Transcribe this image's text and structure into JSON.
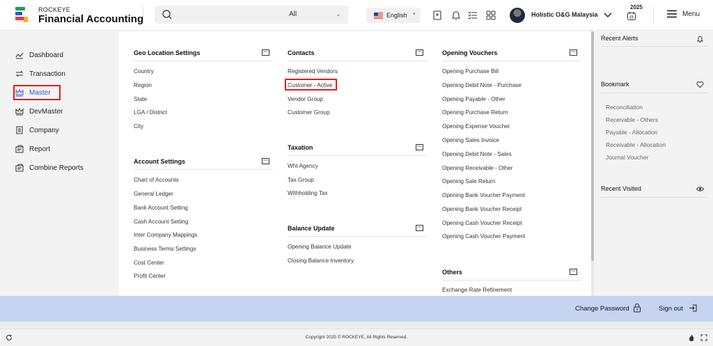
{
  "header": {
    "brand_small": "ROCKEYE",
    "brand_big": "Financial Accounting",
    "search_scope": "All",
    "language": "English",
    "company": "Holistic O&G Malaysia",
    "year": "2025",
    "menu_label": "Menu"
  },
  "sidebar": {
    "items": [
      {
        "label": "Dashboard",
        "icon": "dashboard-icon"
      },
      {
        "label": "Transaction",
        "icon": "transfer-icon"
      },
      {
        "label": "Master",
        "icon": "crown-icon"
      },
      {
        "label": "DevMaster",
        "icon": "crown-icon"
      },
      {
        "label": "Company",
        "icon": "building-icon"
      },
      {
        "label": "Report",
        "icon": "report-icon"
      },
      {
        "label": "Combine Reports",
        "icon": "report-icon"
      }
    ],
    "active": "Master"
  },
  "panel": {
    "geo": {
      "title": "Geo Location Settings",
      "items": [
        "Country",
        "Region",
        "State",
        "LGA / District",
        "City"
      ]
    },
    "account": {
      "title": "Account Settings",
      "items": [
        "Chart of Accounts",
        "General Ledger",
        "Bank Account Setting",
        "Cash Account Setting",
        "Inter Company Mappings",
        "Business Terms Settings",
        "Cost Center",
        "Profit Center"
      ]
    },
    "contacts": {
      "title": "Contacts",
      "items": [
        "Registered Vendors",
        "Customer - Active",
        "Vendor Group",
        "Customer Group"
      ]
    },
    "taxation": {
      "title": "Taxation",
      "items": [
        "Wht Agency",
        "Tax Group",
        "Withholding Tax"
      ]
    },
    "balance": {
      "title": "Balance Update",
      "items": [
        "Opening Balance Update",
        "Closing Balance Inventory"
      ]
    },
    "opening": {
      "title": "Opening Vouchers",
      "items": [
        "Opening Purchase Bill",
        "Opening Debit Note - Purchase",
        "Opening Payable - Other",
        "Opening Purchase Return",
        "Opening Expense Voucher",
        "Opening Sales Invoice",
        "Opening Debit Note - Sales",
        "Opening Receivable - Other",
        "Opening Sale Return",
        "Opening Bank Voucher Payment",
        "Opening Bank Voucher Receipt",
        "Opening Cash Voucher Receipt",
        "Opening Cash Voucher Payment"
      ]
    },
    "others": {
      "title": "Others",
      "items": [
        "Exchange Rate Refinement"
      ]
    }
  },
  "right": {
    "alerts_title": "Recent Alerts",
    "bookmark_title": "Bookmark",
    "bookmarks": [
      "Reconciliation",
      "Receivable - Others",
      "Payable - Allocation",
      "Receivable - Allocation",
      "Journal Voucher"
    ],
    "visited_title": "Recent Visited"
  },
  "footer": {
    "change_password": "Change Password",
    "sign_out": "Sign out",
    "copyright": "Copyright 2025 © ROCKEYE. All Rights Reserved."
  },
  "colors": {
    "accent": "#2b5ec1",
    "highlight": "#e31b1b",
    "footer_bar": "#c6d3f1"
  }
}
